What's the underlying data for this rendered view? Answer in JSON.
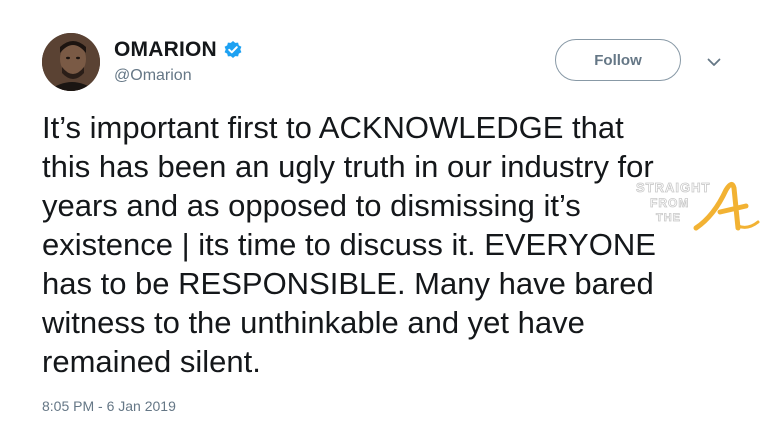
{
  "user": {
    "display_name": "OMARION",
    "handle": "@Omarion",
    "verified": true
  },
  "actions": {
    "follow_label": "Follow"
  },
  "tweet": {
    "text": "It’s important first to ACKNOWLEDGE that\nthis has been an ugly truth in our industry for\nyears and as opposed to dismissing it’s\nexistence | its time to discuss it. EVERYONE\nhas to be RESPONSIBLE. Many have bared\nwitness to the unthinkable and yet have\nremained silent.",
    "timestamp": "8:05 PM - 6 Jan 2019"
  },
  "watermark": {
    "text": "STRAIGHT FROM THE A"
  },
  "colors": {
    "verified_blue": "#1da1f2",
    "text_primary": "#14171a",
    "text_secondary": "#657786",
    "watermark_gold": "#f2b233"
  },
  "icons": {
    "verified": "verified-badge-icon",
    "caret": "chevron-down-icon"
  }
}
